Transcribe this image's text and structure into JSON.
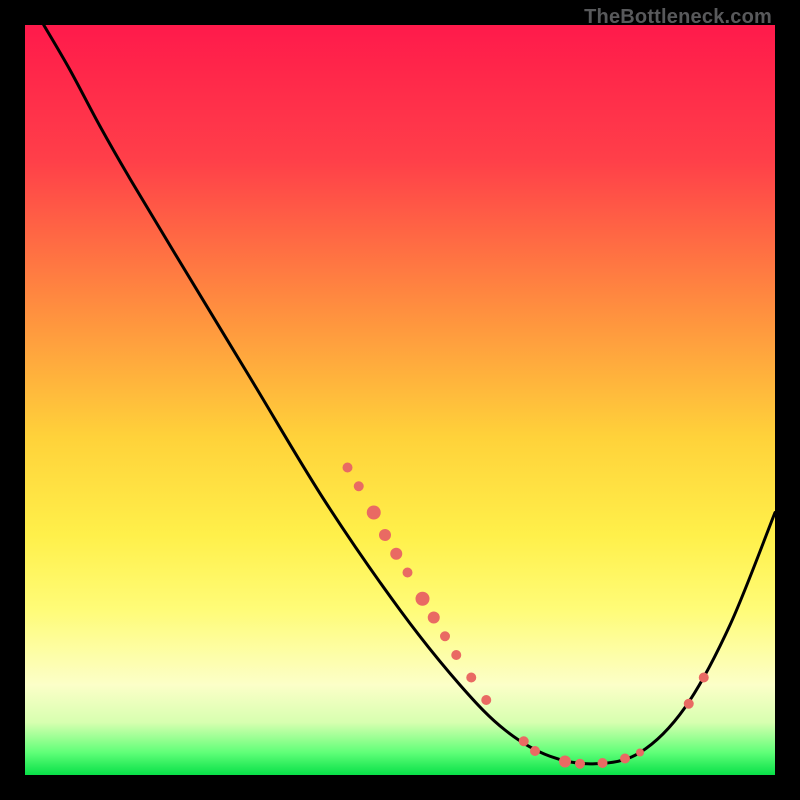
{
  "watermark": "TheBottleneck.com",
  "chart_data": {
    "type": "line",
    "title": "",
    "xlabel": "",
    "ylabel": "",
    "xlim": [
      0,
      100
    ],
    "ylim": [
      0,
      100
    ],
    "gradient_stops": [
      {
        "offset": 0,
        "color": "#ff1a4b"
      },
      {
        "offset": 18,
        "color": "#ff3f49"
      },
      {
        "offset": 38,
        "color": "#ff8f3f"
      },
      {
        "offset": 55,
        "color": "#ffd23a"
      },
      {
        "offset": 68,
        "color": "#fff04a"
      },
      {
        "offset": 78,
        "color": "#fffc78"
      },
      {
        "offset": 88,
        "color": "#fcffc8"
      },
      {
        "offset": 93,
        "color": "#d7ffb0"
      },
      {
        "offset": 97,
        "color": "#60ff78"
      },
      {
        "offset": 100,
        "color": "#08e048"
      }
    ],
    "series": [
      {
        "name": "bottleneck-curve",
        "type": "line",
        "color": "#000000",
        "points": [
          {
            "x": 2.5,
            "y": 100.0
          },
          {
            "x": 6.0,
            "y": 94.0
          },
          {
            "x": 10.0,
            "y": 86.5
          },
          {
            "x": 14.0,
            "y": 79.5
          },
          {
            "x": 20.0,
            "y": 69.5
          },
          {
            "x": 30.0,
            "y": 53.0
          },
          {
            "x": 40.0,
            "y": 36.5
          },
          {
            "x": 50.0,
            "y": 22.0
          },
          {
            "x": 58.0,
            "y": 12.0
          },
          {
            "x": 64.0,
            "y": 6.0
          },
          {
            "x": 70.0,
            "y": 2.5
          },
          {
            "x": 76.0,
            "y": 1.5
          },
          {
            "x": 82.0,
            "y": 3.0
          },
          {
            "x": 88.0,
            "y": 9.0
          },
          {
            "x": 94.0,
            "y": 20.0
          },
          {
            "x": 100.0,
            "y": 35.0
          }
        ]
      },
      {
        "name": "data-markers",
        "type": "scatter",
        "color": "#e96a63",
        "points": [
          {
            "x": 43.0,
            "y": 41.0,
            "r": 5
          },
          {
            "x": 44.5,
            "y": 38.5,
            "r": 5
          },
          {
            "x": 46.5,
            "y": 35.0,
            "r": 7
          },
          {
            "x": 48.0,
            "y": 32.0,
            "r": 6
          },
          {
            "x": 49.5,
            "y": 29.5,
            "r": 6
          },
          {
            "x": 51.0,
            "y": 27.0,
            "r": 5
          },
          {
            "x": 53.0,
            "y": 23.5,
            "r": 7
          },
          {
            "x": 54.5,
            "y": 21.0,
            "r": 6
          },
          {
            "x": 56.0,
            "y": 18.5,
            "r": 5
          },
          {
            "x": 57.5,
            "y": 16.0,
            "r": 5
          },
          {
            "x": 59.5,
            "y": 13.0,
            "r": 5
          },
          {
            "x": 61.5,
            "y": 10.0,
            "r": 5
          },
          {
            "x": 66.5,
            "y": 4.5,
            "r": 5
          },
          {
            "x": 68.0,
            "y": 3.2,
            "r": 5
          },
          {
            "x": 72.0,
            "y": 1.8,
            "r": 6
          },
          {
            "x": 74.0,
            "y": 1.5,
            "r": 5
          },
          {
            "x": 77.0,
            "y": 1.6,
            "r": 5
          },
          {
            "x": 80.0,
            "y": 2.2,
            "r": 5
          },
          {
            "x": 82.0,
            "y": 3.0,
            "r": 4
          },
          {
            "x": 88.5,
            "y": 9.5,
            "r": 5
          },
          {
            "x": 90.5,
            "y": 13.0,
            "r": 5
          }
        ]
      }
    ]
  }
}
